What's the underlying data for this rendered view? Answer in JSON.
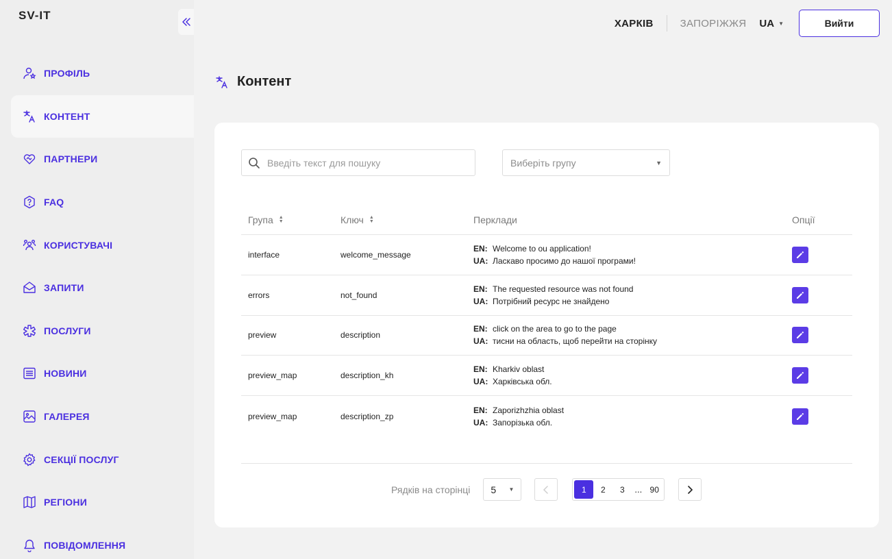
{
  "app": {
    "logo": "SV-IT"
  },
  "sidebar": {
    "items": [
      {
        "label": "ПРОФІЛЬ",
        "icon": "user-star-icon",
        "active": false
      },
      {
        "label": "КОНТЕНТ",
        "icon": "translate-icon",
        "active": true
      },
      {
        "label": "ПАРТНЕРИ",
        "icon": "handshake-heart-icon",
        "active": false
      },
      {
        "label": "FAQ",
        "icon": "question-shield-icon",
        "active": false
      },
      {
        "label": "КОРИСТУВАЧІ",
        "icon": "users-icon",
        "active": false
      },
      {
        "label": "ЗАПИТИ",
        "icon": "envelope-icon",
        "active": false
      },
      {
        "label": "ПОСЛУГИ",
        "icon": "asterisk-icon",
        "active": false
      },
      {
        "label": "НОВИНИ",
        "icon": "news-icon",
        "active": false
      },
      {
        "label": "ГАЛЕРЕЯ",
        "icon": "gallery-icon",
        "active": false
      },
      {
        "label": "СЕКЦІЇ ПОСЛУГ",
        "icon": "gear-icon",
        "active": false
      },
      {
        "label": "РЕГІОНИ",
        "icon": "map-icon",
        "active": false
      },
      {
        "label": "ПОВІДОМЛЕННЯ",
        "icon": "bell-icon",
        "active": false
      }
    ]
  },
  "header": {
    "cities": [
      "ХАРКІВ",
      "ЗАПОРІЖЖЯ"
    ],
    "active_city": "ХАРКІВ",
    "language": "UA",
    "logout_label": "Вийти"
  },
  "page": {
    "title": "Контент"
  },
  "filters": {
    "search_placeholder": "Введіть текст для пошуку",
    "group_placeholder": "Виберіть групу"
  },
  "table": {
    "headers": {
      "group": "Група",
      "key": "Ключ",
      "translations": "Перклади",
      "options": "Опції"
    },
    "rows": [
      {
        "group": "interface",
        "key": "welcome_message",
        "en": "Welcome to ou application!",
        "ua": "Ласкаво просимо до нашої програми!"
      },
      {
        "group": "errors",
        "key": "not_found",
        "en": "The requested resource was not found",
        "ua": "Потрібний ресурс не знайдено"
      },
      {
        "group": "preview",
        "key": "description",
        "en": "click on the area to go to the page",
        "ua": "тисни на область, щоб перейти на сторінку"
      },
      {
        "group": "preview_map",
        "key": "description_kh",
        "en": "Kharkiv oblast",
        "ua": "Харківська обл."
      },
      {
        "group": "preview_map",
        "key": "description_zp",
        "en": "Zaporizhzhia oblast",
        "ua": "Запорізька обл."
      }
    ],
    "en_label": "EN:",
    "ua_label": "UA:"
  },
  "pagination": {
    "rows_label": "Рядків на сторінці",
    "rows_per_page": "5",
    "pages": [
      "1",
      "2",
      "3"
    ],
    "ellipsis": "...",
    "last_page": "90",
    "current_page": "1"
  },
  "colors": {
    "accent": "#4a2fe0",
    "edit_button": "#5b3ce6",
    "background": "#f2f2f2"
  }
}
